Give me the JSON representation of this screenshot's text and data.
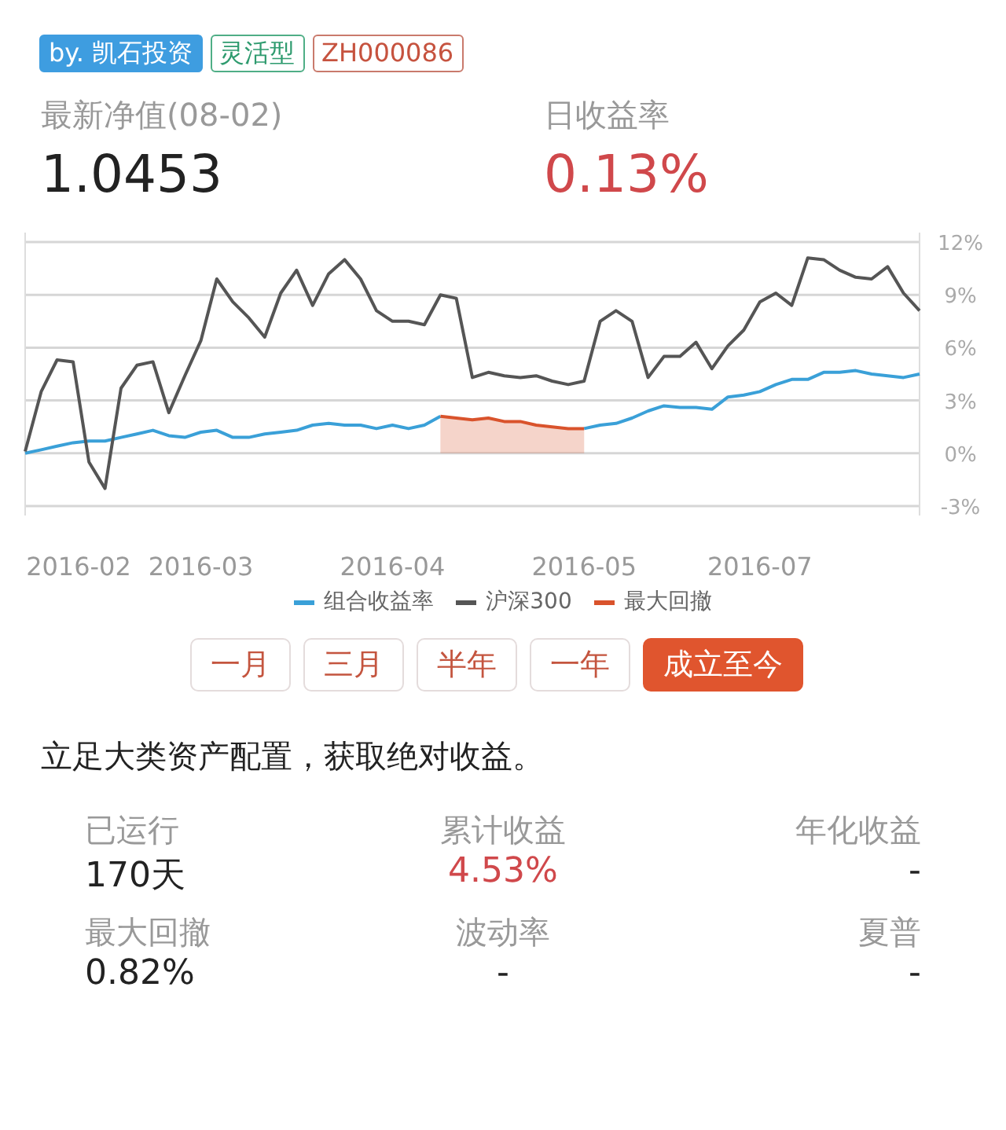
{
  "tags": [
    {
      "label": "by. 凯石投资",
      "kind": "filled"
    },
    {
      "label": "灵活型",
      "kind": "green"
    },
    {
      "label": "ZH000086",
      "kind": "red"
    }
  ],
  "headline": [
    {
      "label": "最新净值(08-02)",
      "value": "1.0453",
      "highlight": false
    },
    {
      "label": "日收益率",
      "value": "0.13%",
      "highlight": true
    }
  ],
  "chart": {
    "chart_data": {
      "type": "line",
      "categories": [
        null,
        null,
        null,
        "2016-02",
        null,
        null,
        null,
        null,
        null,
        null,
        null,
        "2016-03",
        null,
        null,
        null,
        null,
        null,
        null,
        null,
        null,
        null,
        null,
        null,
        "2016-04",
        null,
        null,
        null,
        null,
        null,
        null,
        null,
        null,
        null,
        null,
        null,
        "2016-05",
        null,
        null,
        null,
        null,
        null,
        null,
        null,
        null,
        null,
        null,
        "2016-07",
        null,
        null,
        null,
        null,
        null,
        null,
        null,
        null,
        null,
        null
      ],
      "ylim": [
        -3,
        12
      ],
      "grid": true,
      "yticks": [
        {
          "value": 12,
          "label": "12%"
        },
        {
          "value": 9,
          "label": "9%"
        },
        {
          "value": 6,
          "label": "6%"
        },
        {
          "value": 3,
          "label": "3%"
        },
        {
          "value": 0,
          "label": "0%"
        },
        {
          "value": -3,
          "label": "-3%"
        }
      ],
      "series": [
        {
          "name": "组合收益率",
          "color": "#3aa0d8",
          "values": [
            0,
            0.2,
            0.4,
            0.6,
            0.7,
            0.7,
            0.9,
            1.1,
            1.3,
            1.0,
            0.9,
            1.2,
            1.3,
            0.9,
            0.9,
            1.1,
            1.2,
            1.3,
            1.6,
            1.7,
            1.6,
            1.6,
            1.4,
            1.6,
            1.4,
            1.6,
            2.1,
            null,
            null,
            null,
            null,
            null,
            null,
            null,
            null,
            1.4,
            1.6,
            1.7,
            2.0,
            2.4,
            2.7,
            2.6,
            2.6,
            2.5,
            3.2,
            3.3,
            3.5,
            3.9,
            4.2,
            4.2,
            4.6,
            4.6,
            4.7,
            4.5,
            4.4,
            4.3,
            4.5
          ]
        },
        {
          "name": "沪深300",
          "color": "#555555",
          "values": [
            0.1,
            3.5,
            5.3,
            5.2,
            -0.5,
            -2.0,
            3.7,
            5.0,
            5.2,
            2.3,
            4.4,
            6.4,
            9.9,
            8.6,
            7.7,
            6.6,
            9.1,
            10.4,
            8.4,
            10.2,
            11.0,
            9.9,
            8.1,
            7.5,
            7.5,
            7.3,
            9.0,
            8.8,
            4.3,
            4.6,
            4.4,
            4.3,
            4.4,
            4.1,
            3.9,
            4.1,
            7.5,
            8.1,
            7.5,
            4.3,
            5.5,
            5.5,
            6.3,
            4.8,
            6.1,
            7.0,
            8.6,
            9.1,
            8.4,
            11.1,
            11.0,
            10.4,
            10.0,
            9.9,
            10.6,
            9.1,
            8.1
          ]
        },
        {
          "name": "最大回撤",
          "color": "#d9532c",
          "values": [
            null,
            null,
            null,
            null,
            null,
            null,
            null,
            null,
            null,
            null,
            null,
            null,
            null,
            null,
            null,
            null,
            null,
            null,
            null,
            null,
            null,
            null,
            null,
            null,
            null,
            null,
            2.1,
            2.0,
            1.9,
            2.0,
            1.8,
            1.8,
            1.6,
            1.5,
            1.4,
            1.4,
            null,
            null,
            null,
            null,
            null,
            null,
            null,
            null,
            null,
            null,
            null,
            null,
            null,
            null,
            null,
            null,
            null,
            null,
            null,
            null,
            null
          ]
        }
      ]
    }
  },
  "periods": [
    {
      "label": "一月",
      "selected": false
    },
    {
      "label": "三月",
      "selected": false
    },
    {
      "label": "半年",
      "selected": false
    },
    {
      "label": "一年",
      "selected": false
    },
    {
      "label": "成立至今",
      "selected": true
    }
  ],
  "motto": "立足大类资产配置，获取绝对收益。",
  "stats": [
    {
      "label": "已运行",
      "value": "170天",
      "highlight": false
    },
    {
      "label": "累计收益",
      "value": "4.53%",
      "highlight": true
    },
    {
      "label": "年化收益",
      "value": "-",
      "highlight": false
    },
    {
      "label": "最大回撤",
      "value": "0.82%",
      "highlight": false
    },
    {
      "label": "波动率",
      "value": "-",
      "highlight": false
    },
    {
      "label": "夏普",
      "value": "-",
      "highlight": false
    }
  ]
}
